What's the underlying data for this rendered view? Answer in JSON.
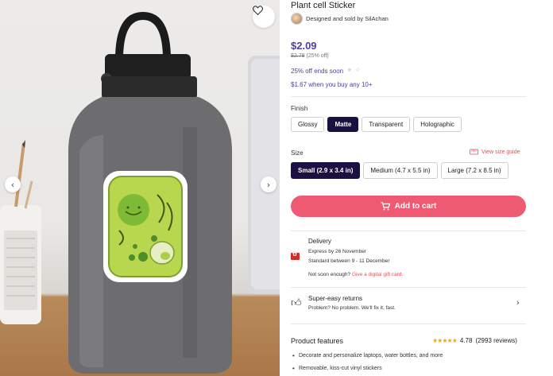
{
  "product": {
    "title": "Plant cell Sticker",
    "designer_text": "Designed and sold by SilAchan",
    "price": "$2.09",
    "old_price": "$2.78",
    "discount_pct": "(25% off)",
    "sale_text": "25% off ends soon",
    "bulk_text": "$1.67 when you buy any 10+"
  },
  "finish": {
    "label": "Finish",
    "options": [
      "Glossy",
      "Matte",
      "Transparent",
      "Holographic"
    ],
    "selected": "Matte"
  },
  "size": {
    "label": "Size",
    "guide_label": "View size guide",
    "options": [
      "Small (2.9 x 3.4 in)",
      "Medium (4.7 x 5.5 in)",
      "Large (7.2 x 8.5 in)"
    ],
    "selected": "Small (2.9 x 3.4 in)"
  },
  "cart": {
    "label": "Add to cart"
  },
  "delivery": {
    "title": "Delivery",
    "express": "Express by 26 November",
    "standard": "Standard between 9 - 11 December",
    "not_soon": "Not soon enough?",
    "gift_link": "Give a digital gift card."
  },
  "returns": {
    "title": "Super-easy returns",
    "subtitle": "Problem? No problem. We'll fix it, fast."
  },
  "features": {
    "title": "Product features",
    "rating_value": "4.78",
    "rating_count": "(2993 reviews)",
    "items": [
      "Decorate and personalize laptops, water bottles, and more",
      "Removable, kiss-cut vinyl stickers"
    ]
  },
  "icons": {
    "favorite": "heart-icon",
    "prev": "chevron-left-icon",
    "next": "chevron-right-icon",
    "cart": "cart-icon",
    "size_guide": "ruler-icon",
    "returns": "thumbs-up-icon",
    "returns_chevron": "chevron-right-icon"
  },
  "colors": {
    "price": "#4e3ca8",
    "cart_button": "#ef5a73",
    "selected_option": "#1a1140",
    "link": "#e0515e",
    "stars": "#f2a51a"
  }
}
